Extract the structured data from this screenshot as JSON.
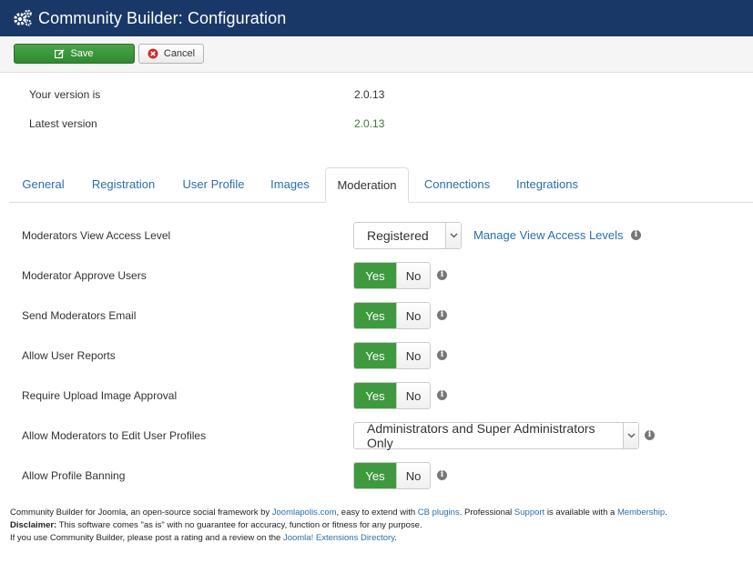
{
  "header": {
    "title": "Community Builder: Configuration",
    "icon": "gears-icon"
  },
  "toolbar": {
    "save_label": "Save",
    "cancel_label": "Cancel"
  },
  "version": {
    "your_label": "Your version is",
    "your_value": "2.0.13",
    "latest_label": "Latest version",
    "latest_value": "2.0.13",
    "latest_color": "#3c763d"
  },
  "tabs": [
    {
      "label": "General"
    },
    {
      "label": "Registration"
    },
    {
      "label": "User Profile"
    },
    {
      "label": "Images"
    },
    {
      "label": "Moderation"
    },
    {
      "label": "Connections"
    },
    {
      "label": "Integrations"
    }
  ],
  "active_tab": "Moderation",
  "settings": {
    "view_access": {
      "label": "Moderators View Access Level",
      "value": "Registered",
      "link": "Manage View Access Levels"
    },
    "approve_users": {
      "label": "Moderator Approve Users",
      "yes": "Yes",
      "no": "No",
      "selected": "Yes"
    },
    "send_email": {
      "label": "Send Moderators Email",
      "yes": "Yes",
      "no": "No",
      "selected": "Yes"
    },
    "user_reports": {
      "label": "Allow User Reports",
      "yes": "Yes",
      "no": "No",
      "selected": "Yes"
    },
    "image_approval": {
      "label": "Require Upload Image Approval",
      "yes": "Yes",
      "no": "No",
      "selected": "Yes"
    },
    "edit_profiles": {
      "label": "Allow Moderators to Edit User Profiles",
      "value": "Administrators and Super Administrators Only"
    },
    "profile_banning": {
      "label": "Allow Profile Banning",
      "yes": "Yes",
      "no": "No",
      "selected": "Yes"
    }
  },
  "footer": {
    "l1_a": "Community Builder for Joomla, an open-source social framework by ",
    "l1_link1": "Joomlapolis.com",
    "l1_b": ", easy to extend with ",
    "l1_link2": "CB plugins",
    "l1_c": ". Professional ",
    "l1_link3": "Support",
    "l1_d": " is available with a ",
    "l1_link4": "Membership",
    "l1_e": ".",
    "l2_bold": "Disclaimer:",
    "l2_text": " This software comes \"as is\" with no guarantee for accuracy, function or fitness for any purpose.",
    "l3_a": "If you use Community Builder, please post a rating and a review on the ",
    "l3_link": "Joomla! Extensions Directory",
    "l3_b": "."
  },
  "colors": {
    "header_bg": "#1a3867",
    "save_green": "#3f9a3f",
    "link_blue": "#2a6fad"
  }
}
